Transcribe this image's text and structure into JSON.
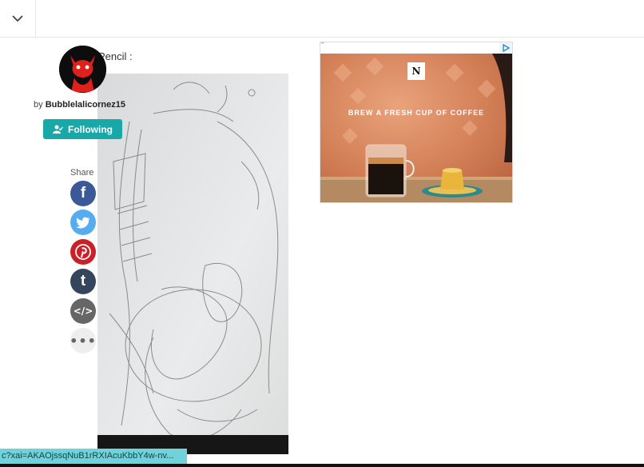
{
  "header": {
    "collapse_icon": "chevron-down-icon"
  },
  "post": {
    "caption": "Pencil :",
    "author_prefix": "by",
    "author": "Bubblelalicornez15",
    "follow_label": "Following",
    "artwork_icon": "pencil-sketch-artwork"
  },
  "share": {
    "label": "Share",
    "buttons": [
      {
        "name": "facebook",
        "color": "#3b5998"
      },
      {
        "name": "twitter",
        "color": "#55acee"
      },
      {
        "name": "pinterest",
        "color": "#cb2027"
      },
      {
        "name": "tumblr",
        "color": "#35465c"
      },
      {
        "name": "embed",
        "color": "#666666"
      },
      {
        "name": "more",
        "color": "#eeeeee"
      }
    ]
  },
  "ad": {
    "quote": "\"",
    "logo": "N",
    "tagline": "BREW A FRESH CUP OF COFFEE"
  },
  "status_bar": {
    "url": "c?xai=AKAOjssqNuB1rRXIAcuKbbY4w-nv..."
  },
  "colors": {
    "accent": "#18a8a8",
    "status_bar": "#6fd3d9"
  }
}
